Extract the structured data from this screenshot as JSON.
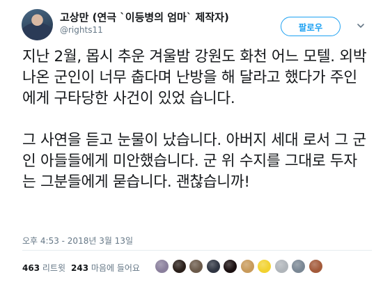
{
  "user": {
    "display_name": "고상만 (연극 `이등병의 엄마` 제작자)",
    "handle": "@rights11"
  },
  "follow_label": "팔로우",
  "tweet": {
    "paragraphs": [
      "지난 2월, 몹시 추운 겨울밤 강원도 화천 어느 모텔. 외박 나온 군인이 너무 춥다며 난방을 해 달라고 했다가 주인에게 구타당한 사건이 있었 습니다.",
      "그 사연을 듣고 눈물이 났습니다. 아버지 세대 로서 그 군인 아들들에게 미안했습니다. 군 위 수지를 그대로 두자는 그분들에게 묻습니다. 괜찮습니까!"
    ]
  },
  "timestamp": "오후 4:53 - 2018년 3월 13일",
  "stats": {
    "retweet_count": "463",
    "retweet_label": "리트윗",
    "like_count": "243",
    "like_label": "마음에 들어요"
  },
  "likers": [
    {
      "icon": "liker-avatar",
      "color": "#8a7f9c"
    },
    {
      "icon": "liker-avatar",
      "color": "#2a1f1a"
    },
    {
      "icon": "liker-avatar",
      "color": "#6b5a4a"
    },
    {
      "icon": "liker-avatar",
      "color": "#2f3542"
    },
    {
      "icon": "liker-avatar",
      "color": "#1a0f10"
    },
    {
      "icon": "liker-avatar",
      "color": "#c89a5a"
    },
    {
      "icon": "liker-avatar",
      "color": "#f2d230"
    },
    {
      "icon": "liker-avatar",
      "color": "#b0b5ba"
    },
    {
      "icon": "liker-avatar",
      "color": "#7a8794"
    },
    {
      "icon": "liker-avatar",
      "color": "#a35a3a"
    }
  ]
}
